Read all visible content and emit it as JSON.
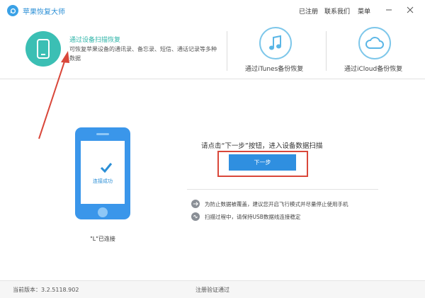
{
  "app": {
    "title": "苹果恢复大师"
  },
  "titlebar": {
    "menu": {
      "registered": "已注册",
      "contact": "联系我们",
      "menu": "菜单"
    }
  },
  "modes": {
    "device": {
      "title": "通过设备扫描恢复",
      "description": "可恢复苹果设备的通讯录、备忘录、短信、通话记录等多种数据",
      "icon": "phone-icon",
      "color": "#3bbfb4"
    },
    "itunes": {
      "label": "通过iTunes备份恢复",
      "icon": "music-note-icon"
    },
    "icloud": {
      "label": "通过iCloud备份恢复",
      "icon": "cloud-icon"
    }
  },
  "device": {
    "status_text": "连接成功",
    "connected_label": "\"L\"已连接",
    "icon": "check-icon"
  },
  "main": {
    "prompt": "请点击“下一步”按钮，进入设备数据扫描",
    "next_button": "下一步",
    "tips": [
      {
        "icon": "airplane-icon",
        "text": "为防止数据被覆盖，建议您开启飞行模式并尽量停止使用手机"
      },
      {
        "icon": "link-icon",
        "text": "扫描过程中，请保持USB数据线连接稳定"
      }
    ]
  },
  "status": {
    "version": "当前版本：3.2.5118.902",
    "registration": "注册验证通过"
  },
  "colors": {
    "accent": "#2f8fe0",
    "teal": "#3bbfb4",
    "highlight": "#d9473a"
  }
}
